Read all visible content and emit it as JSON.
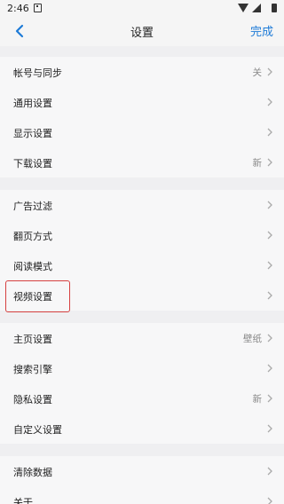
{
  "status_bar": {
    "time": "2:46"
  },
  "header": {
    "title": "设置",
    "done_label": "完成"
  },
  "sections": [
    [
      {
        "label": "帐号与同步",
        "value": "关"
      },
      {
        "label": "通用设置",
        "value": ""
      },
      {
        "label": "显示设置",
        "value": ""
      },
      {
        "label": "下载设置",
        "value": "新"
      }
    ],
    [
      {
        "label": "广告过滤",
        "value": ""
      },
      {
        "label": "翻页方式",
        "value": ""
      },
      {
        "label": "阅读模式",
        "value": ""
      },
      {
        "label": "视频设置",
        "value": ""
      }
    ],
    [
      {
        "label": "主页设置",
        "value": "壁纸"
      },
      {
        "label": "搜索引擎",
        "value": ""
      },
      {
        "label": "隐私设置",
        "value": "新"
      },
      {
        "label": "自定义设置",
        "value": ""
      }
    ],
    [
      {
        "label": "清除数据",
        "value": ""
      },
      {
        "label": "关于",
        "value": ""
      }
    ]
  ],
  "colors": {
    "accent": "#1e7bd7",
    "highlight": "#d64040"
  }
}
